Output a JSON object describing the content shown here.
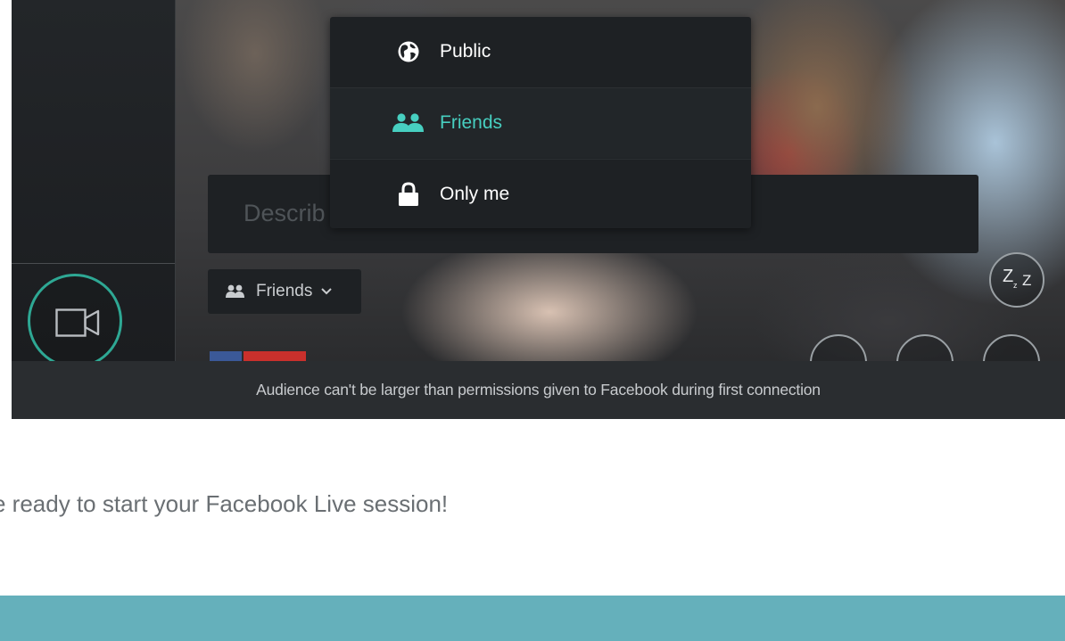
{
  "dropdown": {
    "items": [
      {
        "label": "Public",
        "icon": "globe-icon",
        "selected": false
      },
      {
        "label": "Friends",
        "icon": "friends-icon",
        "selected": true
      },
      {
        "label": "Only me",
        "icon": "lock-icon",
        "selected": false
      }
    ]
  },
  "description": {
    "placeholder": "Describ"
  },
  "audience_button": {
    "label": "Friends"
  },
  "info_bar": {
    "text": "Audience can't be larger than permissions given to Facebook during first connection"
  },
  "status_text": "e ready to start your Facebook Live session!",
  "icons": {
    "camera": "video-camera-icon",
    "sleep": "zzz-icon",
    "chevron": "chevron-down-icon"
  },
  "colors": {
    "accent_teal": "#47cfc0",
    "camera_ring": "#2ea894",
    "panel_dark": "#1e2124",
    "info_bar": "#2a2d30",
    "bottom_bar": "#65b0bb",
    "facebook_blue": "#3b5998",
    "live_red": "#c9302c"
  }
}
